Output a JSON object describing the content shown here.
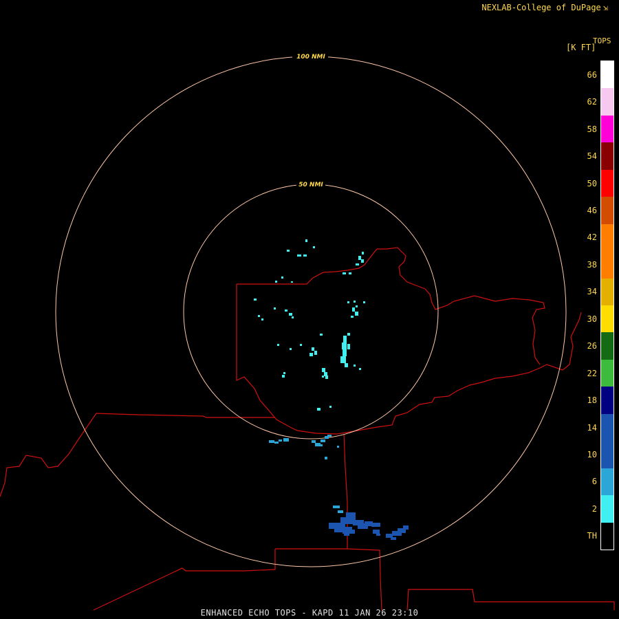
{
  "credit": {
    "text": "NEXLAB-College of DuPage",
    "glyph": "⇲"
  },
  "legend": {
    "title": "TOPS",
    "unit": "[K FT]",
    "bins": [
      {
        "label": "66",
        "color": "#ffffff"
      },
      {
        "label": "62",
        "color": "#f7c8f0"
      },
      {
        "label": "58",
        "color": "#ff00d6"
      },
      {
        "label": "54",
        "color": "#8a0000"
      },
      {
        "label": "50",
        "color": "#ff0000"
      },
      {
        "label": "46",
        "color": "#d24d00"
      },
      {
        "label": "42",
        "color": "#ff7e00"
      },
      {
        "label": "38",
        "color": "#ff7e00"
      },
      {
        "label": "34",
        "color": "#e3b000"
      },
      {
        "label": "30",
        "color": "#ffdd00"
      },
      {
        "label": "26",
        "color": "#146b14"
      },
      {
        "label": "22",
        "color": "#3dbb3d"
      },
      {
        "label": "18",
        "color": "#000080"
      },
      {
        "label": "14",
        "color": "#1c55b0"
      },
      {
        "label": "10",
        "color": "#1c55b0"
      },
      {
        "label": "6",
        "color": "#2ba6d6"
      },
      {
        "label": "2",
        "color": "#40f0f0"
      },
      {
        "label": "TH",
        "color": "#000000"
      }
    ]
  },
  "rings": [
    {
      "label": "100 NMI"
    },
    {
      "label": "50 NMI"
    }
  ],
  "product": {
    "text": "ENHANCED ECHO TOPS - KAPD 11 JAN 26 23:10"
  },
  "colors": {
    "ring": "#ffc8a8",
    "border": "#d01010",
    "background": "#000000"
  }
}
